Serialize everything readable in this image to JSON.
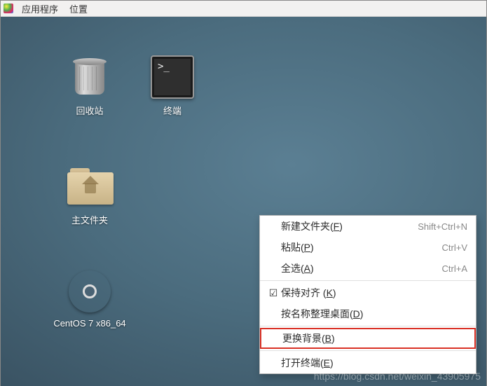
{
  "menubar": {
    "apps": "应用程序",
    "locations": "位置"
  },
  "desktop_icons": {
    "trash": "回收站",
    "terminal": "终端",
    "home": "主文件夹",
    "disc": "CentOS 7 x86_64"
  },
  "context_menu": {
    "new_folder": {
      "label": "新建文件夹(",
      "mnemonic": "F",
      "suffix": ")",
      "shortcut": "Shift+Ctrl+N"
    },
    "paste": {
      "label": "粘贴(",
      "mnemonic": "P",
      "suffix": ")",
      "shortcut": "Ctrl+V"
    },
    "select_all": {
      "label": "全选(",
      "mnemonic": "A",
      "suffix": ")",
      "shortcut": "Ctrl+A"
    },
    "keep_aligned": {
      "label": "保持对齐 (",
      "mnemonic": "K",
      "suffix": ")",
      "checked": true
    },
    "organize_by_name": {
      "label": "按名称整理桌面(",
      "mnemonic": "D",
      "suffix": ")"
    },
    "change_background": {
      "label": "更换背景(",
      "mnemonic": "B",
      "suffix": ")"
    },
    "open_terminal": {
      "label": "打开终端(",
      "mnemonic": "E",
      "suffix": ")"
    }
  },
  "watermark": "https://blog.csdn.net/weixin_43905975"
}
